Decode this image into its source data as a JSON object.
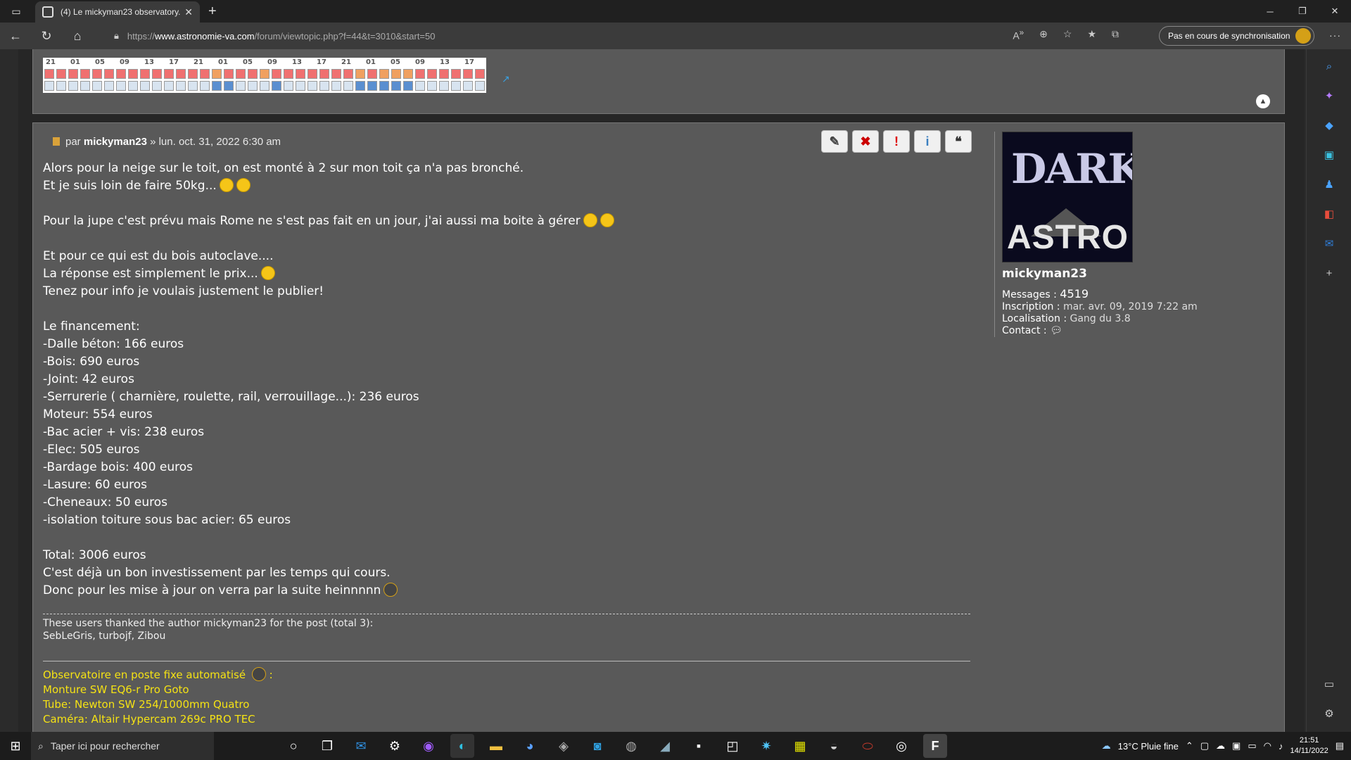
{
  "browser": {
    "tab_title": "(4) Le mickyman23 observatory...",
    "url_prefix": "https://",
    "url_host": "www.astronomie-va.com",
    "url_path": "/forum/viewtopic.php?f=44&t=3010&start=50",
    "sync_label": "Pas en cours de synchronisation"
  },
  "prev_post": {
    "hours_labels": [
      "21",
      "01",
      "05",
      "09",
      "13",
      "17",
      "21",
      "01",
      "05",
      "09",
      "13",
      "17",
      "21",
      "01",
      "05",
      "09",
      "13",
      "17"
    ]
  },
  "post": {
    "by_label": "par",
    "author": "mickyman23",
    "date": "» lun. oct. 31, 2022 6:30 am",
    "lines": [
      "Alors pour la neige sur le toit, on est monté à 2 sur mon toit ça n'a pas bronché.",
      "Et je suis loin de faire 50kg...",
      "",
      "Pour la jupe c'est prévu mais Rome ne s'est pas fait en un jour, j'ai aussi ma boite à gérer",
      "",
      "Et pour ce qui est du bois autoclave....",
      "La réponse est simplement le prix...",
      "Tenez pour info je voulais justement le publier!",
      "",
      "Le financement:",
      "-Dalle béton: 166 euros",
      "-Bois: 690 euros",
      "-Joint: 42 euros",
      "-Serrurerie ( charnière, roulette, rail, verrouillage...): 236 euros",
      "Moteur: 554 euros",
      "-Bac acier + vis: 238 euros",
      "-Elec: 505 euros",
      "-Bardage bois: 400 euros",
      "-Lasure: 60 euros",
      "-Cheneaux: 50 euros",
      "-isolation toiture sous bac acier: 65 euros",
      "",
      "Total: 3006 euros",
      "C'est déjà un bon investissement par les temps qui cours.",
      "Donc pour les mise à jour on verra par la suite heinnnnn"
    ],
    "thanks_text": "These users thanked the author mickyman23 for the post (total 3):",
    "thanks_users": "SebLeGris, turbojf, Zibou",
    "signature": [
      "Observatoire en poste fixe automatisé",
      "Monture SW EQ6-r Pro Goto",
      "Tube: Newton SW 254/1000mm Quatro",
      "Caméra: Altair Hypercam 269c PRO TEC"
    ],
    "signature_suffix": ":"
  },
  "profile": {
    "avatar_text_top": "DARK",
    "avatar_text_bottom": "ASTRO",
    "username": "mickyman23",
    "messages_label": "Messages :",
    "messages_value": "4519",
    "inscription_label": "Inscription :",
    "inscription_value": "mar. avr. 09, 2019 7:22 am",
    "localisation_label": "Localisation :",
    "localisation_value": "Gang du 3.8",
    "contact_label": "Contact :"
  },
  "taskbar": {
    "search_placeholder": "Taper ici pour rechercher",
    "weather": "13°C  Pluie fine",
    "time": "21:51",
    "date": "14/11/2022"
  }
}
